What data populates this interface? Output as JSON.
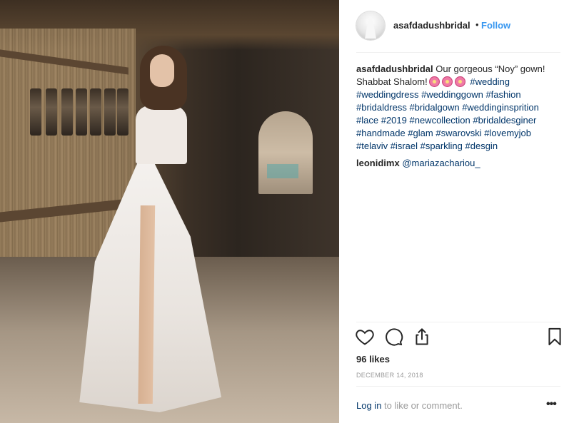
{
  "post": {
    "username": "asafdadushbridal",
    "separator": "•",
    "follow_label": "Follow",
    "caption": {
      "username": "asafdadushbridal",
      "text_line1": "Our gorgeous “Noy” gown!",
      "text_line2": "Shabbat Shalom!",
      "emoji": [
        "hibiscus-emoji",
        "hibiscus-emoji",
        "hibiscus-emoji"
      ],
      "hashtags": [
        "#wedding",
        "#weddingdress",
        "#weddinggown",
        "#fashion",
        "#bridaldress",
        "#bridalgown",
        "#weddinginsprition",
        "#lace",
        "#2019",
        "#newcollection",
        "#bridaldesginer",
        "#handmade",
        "#glam",
        "#swarovski",
        "#lovemyjob",
        "#telaviv",
        "#israel",
        "#sparkling",
        "#desgin"
      ]
    },
    "comment": {
      "username": "leonidimx",
      "mention": "@mariazachariou_"
    },
    "actions": {
      "like_icon": "heart-icon",
      "comment_icon": "comment-bubble-icon",
      "share_icon": "share-icon",
      "save_icon": "bookmark-icon"
    },
    "likes_text": "96 likes",
    "date_text": "December 14, 2018",
    "login": {
      "link_text": "Log in",
      "rest_text": "to like or comment."
    },
    "more_label": "•••"
  },
  "colors": {
    "link_blue": "#3897f0",
    "hashtag": "#003569",
    "muted": "#999999",
    "text": "#262626"
  }
}
